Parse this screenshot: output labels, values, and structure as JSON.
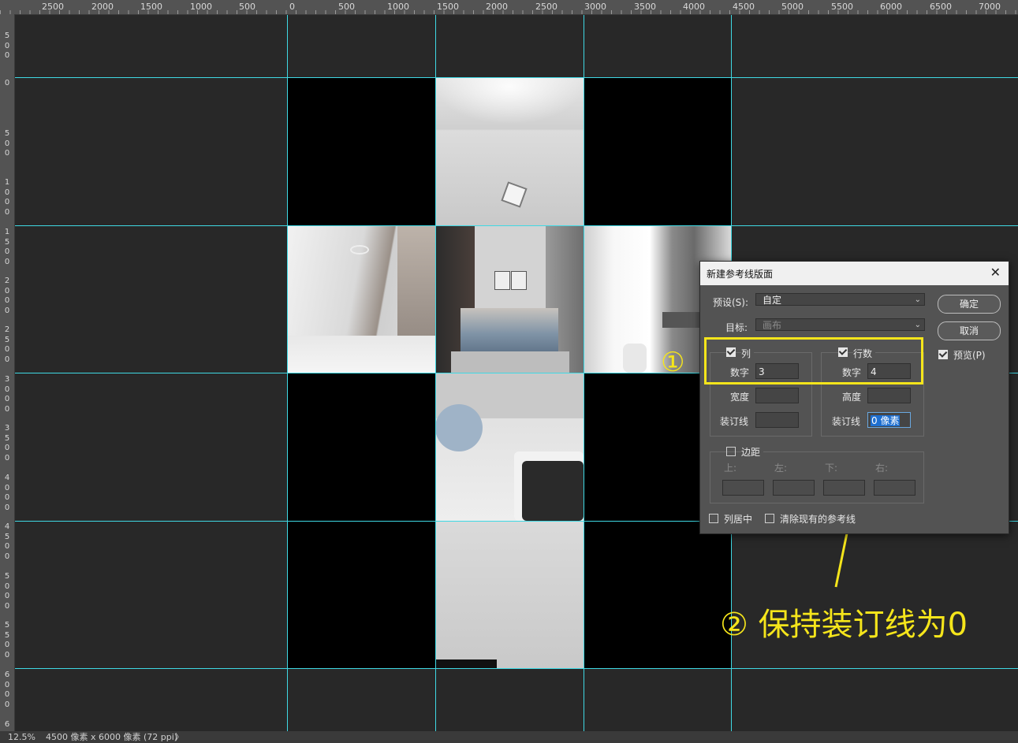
{
  "ruler": {
    "top_labels": [
      "2500",
      "2000",
      "1500",
      "1000",
      "500",
      "0",
      "500",
      "1000",
      "1500",
      "2000",
      "2500",
      "3000",
      "3500",
      "4000",
      "4500",
      "5000",
      "5500",
      "6000",
      "6500",
      "7000"
    ],
    "left_labels": [
      "500",
      "0",
      "500",
      "1000",
      "1500",
      "2000",
      "2500",
      "3000",
      "3500",
      "4000",
      "4500",
      "5000",
      "5500",
      "6000",
      "6"
    ]
  },
  "dialog": {
    "title": "新建参考线版面",
    "close_icon": "close-icon",
    "preset_label": "预设(S):",
    "preset_value": "自定",
    "target_label": "目标:",
    "target_value": "画布",
    "ok_label": "确定",
    "cancel_label": "取消",
    "preview_label": "预览(P)",
    "columns": {
      "label": "列",
      "number_label": "数字",
      "number_value": "3",
      "width_label": "宽度",
      "width_value": "",
      "gutter_label": "装订线",
      "gutter_value": ""
    },
    "rows": {
      "label": "行数",
      "number_label": "数字",
      "number_value": "4",
      "height_label": "高度",
      "height_value": "",
      "gutter_label": "装订线",
      "gutter_value": "0 像素"
    },
    "margin": {
      "label": "边距",
      "top": "上:",
      "left": "左:",
      "bottom": "下:",
      "right": "右:"
    },
    "center_columns_label": "列居中",
    "clear_guides_label": "清除现有的参考线"
  },
  "annotations": {
    "step1": "①",
    "step2": "② 保持装订线为0",
    "color": "#f5e51b"
  },
  "status": {
    "zoom": "12.5%",
    "doc_info": "4500 像素 x 6000 像素 (72 ppi)",
    "arrow": "〉"
  },
  "colors": {
    "guide": "#3fd9e4",
    "highlight": "#f5e51b"
  }
}
